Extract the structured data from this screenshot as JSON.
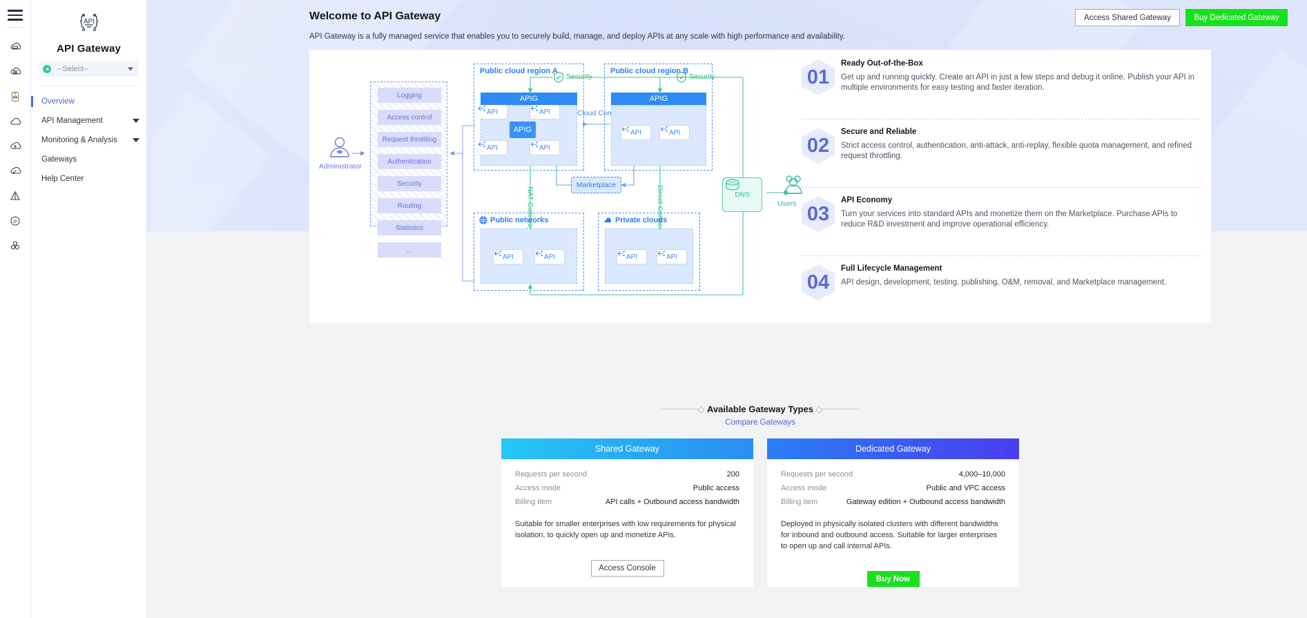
{
  "rail": {
    "menu_icon": "hamburger-icon",
    "icons": [
      {
        "name": "cloud-server-icon"
      },
      {
        "name": "cloud-database-icon"
      },
      {
        "name": "cloud-storage-icon"
      },
      {
        "name": "cloud-icon"
      },
      {
        "name": "cloud-upload-icon"
      },
      {
        "name": "cloud-speed-icon"
      },
      {
        "name": "pyramid-icon"
      },
      {
        "name": "ip-icon"
      },
      {
        "name": "cluster-icon"
      }
    ]
  },
  "sidebar": {
    "logo_text": "API",
    "product_name": "API Gateway",
    "selector": {
      "value": "--Select--",
      "icon": "arrow-circle-icon",
      "caret": "chevron-down-icon"
    },
    "items": [
      {
        "label": "Overview",
        "active": true,
        "expandable": false
      },
      {
        "label": "API Management",
        "active": false,
        "expandable": true
      },
      {
        "label": "Monitoring & Analysis",
        "active": false,
        "expandable": true
      },
      {
        "label": "Gateways",
        "active": false,
        "expandable": false
      },
      {
        "label": "Help Center",
        "active": false,
        "expandable": false
      }
    ]
  },
  "header": {
    "title": "Welcome to API Gateway",
    "description": "API Gateway is a fully managed service that enables you to securely build, manage, and deploy APIs at any scale with high performance and availability.",
    "buttons": [
      {
        "label": "Access Shared Gateway",
        "style": "ghost"
      },
      {
        "label": "Buy Dedicated Gateway",
        "style": "green"
      }
    ]
  },
  "diagram": {
    "administrator_label": "Administrator",
    "capabilities": [
      "Logging",
      "Access control",
      "Request throttling",
      "Authentication",
      "Security",
      "Routing",
      "Statistics",
      "..."
    ],
    "region_a": {
      "title": "Public cloud region A",
      "security_label": "Security",
      "apig_bar": "APIG",
      "apig_core": "APIG",
      "apis": [
        "API",
        "API",
        "API",
        "API"
      ]
    },
    "region_b": {
      "title": "Public cloud region B",
      "security_label": "Security",
      "apig_bar": "APIG",
      "apis": [
        "API",
        "API"
      ]
    },
    "cloud_connect_label": "Cloud Connect",
    "nat_gateway_label": "NAT Gateway",
    "direct_connect_label": "Direct Connect",
    "marketplace_label": "Marketplace",
    "public_networks": {
      "title": "Public networks",
      "icon": "globe-icon",
      "apis": [
        "API",
        "API"
      ]
    },
    "private_clouds": {
      "title": "Private clouds",
      "icon": "cloud-icon",
      "apis": [
        "API",
        "API"
      ]
    },
    "dns": {
      "badge": "DNS",
      "label": "DNS"
    },
    "users_label": "Users"
  },
  "features": [
    {
      "number": "01",
      "title": "Ready Out-of-the-Box",
      "text": "Get up and running quickly. Create an API in just a few steps and debug it online. Publish your API in multiple environments for easy testing and faster iteration."
    },
    {
      "number": "02",
      "title": "Secure and Reliable",
      "text": "Strict access control, authentication, anti-attack, anti-replay, flexible quota management, and refined request throttling."
    },
    {
      "number": "03",
      "title": "API Economy",
      "text": "Turn your services into standard APIs and monetize them on the Marketplace. Purchase APIs to reduce R&D investment and improve operational efficiency."
    },
    {
      "number": "04",
      "title": "Full Lifecycle Management",
      "text": "API design, development, testing, publishing, O&M, removal, and Marketplace management."
    }
  ],
  "gateway_types": {
    "section_title": "Available Gateway Types",
    "compare_link": "Compare Gateways",
    "shared": {
      "title": "Shared Gateway",
      "specs": [
        {
          "key": "Requests per second",
          "value": "200"
        },
        {
          "key": "Access mode",
          "value": "Public access"
        },
        {
          "key": "Billing item",
          "value": "API calls + Outbound access bandwidth"
        }
      ],
      "description": "Suitable for smaller enterprises with low requirements for physical isolation, to quickly open up and monetize APIs.",
      "cta": "Access Console"
    },
    "dedicated": {
      "title": "Dedicated Gateway",
      "specs": [
        {
          "key": "Requests per second",
          "value": "4,000–10,000"
        },
        {
          "key": "Access mode",
          "value": "Public and VPC access"
        },
        {
          "key": "Billing item",
          "value": "Gateway edition + Outbound access bandwidth"
        }
      ],
      "description": "Deployed in physically isolated clusters with different bandwidths for inbound and outbound access. Suitable for larger enterprises to open up and call internal APIs.",
      "cta": "Buy Now"
    }
  },
  "colors": {
    "accent_blue": "#5468d4",
    "brand_blue": "#2e8bf5",
    "green_cta": "#18e01f",
    "teal": "#2fc08a",
    "hero_bg": "#d8e1fc"
  }
}
